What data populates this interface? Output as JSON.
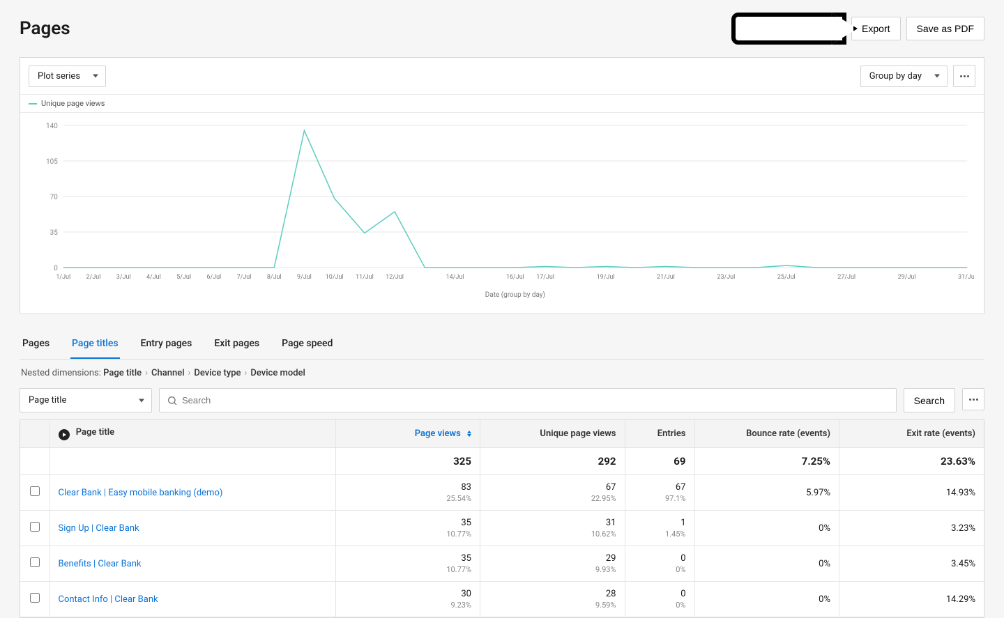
{
  "header": {
    "title": "Pages",
    "export_label": "Export",
    "save_pdf_label": "Save as PDF"
  },
  "chart": {
    "plot_series_label": "Plot series",
    "group_by_label": "Group by day",
    "legend_series": "Unique page views",
    "x_axis_label": "Date (group by day)"
  },
  "tabs": [
    "Pages",
    "Page titles",
    "Entry pages",
    "Exit pages",
    "Page speed"
  ],
  "active_tab_index": 1,
  "breadcrumb": {
    "label": "Nested dimensions:",
    "items": [
      "Page title",
      "Channel",
      "Device type",
      "Device model"
    ]
  },
  "table_toolbar": {
    "dimension_select": "Page title",
    "search_placeholder": "Search",
    "search_button": "Search"
  },
  "table": {
    "columns": [
      "Page title",
      "Page views",
      "Unique page views",
      "Entries",
      "Bounce rate (events)",
      "Exit rate (events)"
    ],
    "sorted_column_index": 1,
    "totals": {
      "page_views": "325",
      "unique_page_views": "292",
      "entries": "69",
      "bounce_rate": "7.25%",
      "exit_rate": "23.63%"
    },
    "rows": [
      {
        "title": "Clear Bank | Easy mobile banking (demo)",
        "page_views": "83",
        "page_views_pct": "25.54%",
        "unique": "67",
        "unique_pct": "22.95%",
        "entries": "67",
        "entries_pct": "97.1%",
        "bounce": "5.97%",
        "exit": "14.93%"
      },
      {
        "title": "Sign Up | Clear Bank",
        "page_views": "35",
        "page_views_pct": "10.77%",
        "unique": "31",
        "unique_pct": "10.62%",
        "entries": "1",
        "entries_pct": "1.45%",
        "bounce": "0%",
        "exit": "3.23%"
      },
      {
        "title": "Benefits | Clear Bank",
        "page_views": "35",
        "page_views_pct": "10.77%",
        "unique": "29",
        "unique_pct": "9.93%",
        "entries": "0",
        "entries_pct": "0%",
        "bounce": "0%",
        "exit": "3.45%"
      },
      {
        "title": "Contact Info | Clear Bank",
        "page_views": "30",
        "page_views_pct": "9.23%",
        "unique": "28",
        "unique_pct": "9.59%",
        "entries": "0",
        "entries_pct": "0%",
        "bounce": "0%",
        "exit": "14.29%"
      }
    ]
  },
  "chart_data": {
    "type": "line",
    "title": "",
    "xlabel": "Date (group by day)",
    "ylabel": "",
    "ylim": [
      0,
      140
    ],
    "yticks": [
      0,
      35,
      70,
      105,
      140
    ],
    "series": [
      {
        "name": "Unique page views",
        "color": "#5ccdc0"
      }
    ],
    "categories": [
      "1/Jul",
      "2/Jul",
      "3/Jul",
      "4/Jul",
      "5/Jul",
      "6/Jul",
      "7/Jul",
      "8/Jul",
      "9/Jul",
      "10/Jul",
      "11/Jul",
      "12/Jul",
      "13/Jul",
      "14/Jul",
      "15/Jul",
      "16/Jul",
      "17/Jul",
      "18/Jul",
      "19/Jul",
      "20/Jul",
      "21/Jul",
      "22/Jul",
      "23/Jul",
      "24/Jul",
      "25/Jul",
      "26/Jul",
      "27/Jul",
      "28/Jul",
      "29/Jul",
      "30/Jul",
      "31/Jul"
    ],
    "x_tick_labels_visible": [
      "1/Jul",
      "2/Jul",
      "3/Jul",
      "4/Jul",
      "5/Jul",
      "6/Jul",
      "7/Jul",
      "8/Jul",
      "9/Jul",
      "10/Jul",
      "11/Jul",
      "12/Jul",
      "",
      "14/Jul",
      "",
      "16/Jul",
      "17/Jul",
      "",
      "19/Jul",
      "",
      "21/Jul",
      "",
      "23/Jul",
      "",
      "25/Jul",
      "",
      "27/Jul",
      "",
      "29/Jul",
      "",
      "31/Jul"
    ],
    "values": [
      0,
      0,
      0,
      0,
      0,
      0,
      0,
      0,
      135,
      68,
      34,
      55,
      0,
      0,
      0,
      0,
      1,
      0,
      1,
      0,
      1,
      0,
      0,
      0,
      2,
      0,
      0,
      0,
      0,
      0,
      0
    ]
  }
}
